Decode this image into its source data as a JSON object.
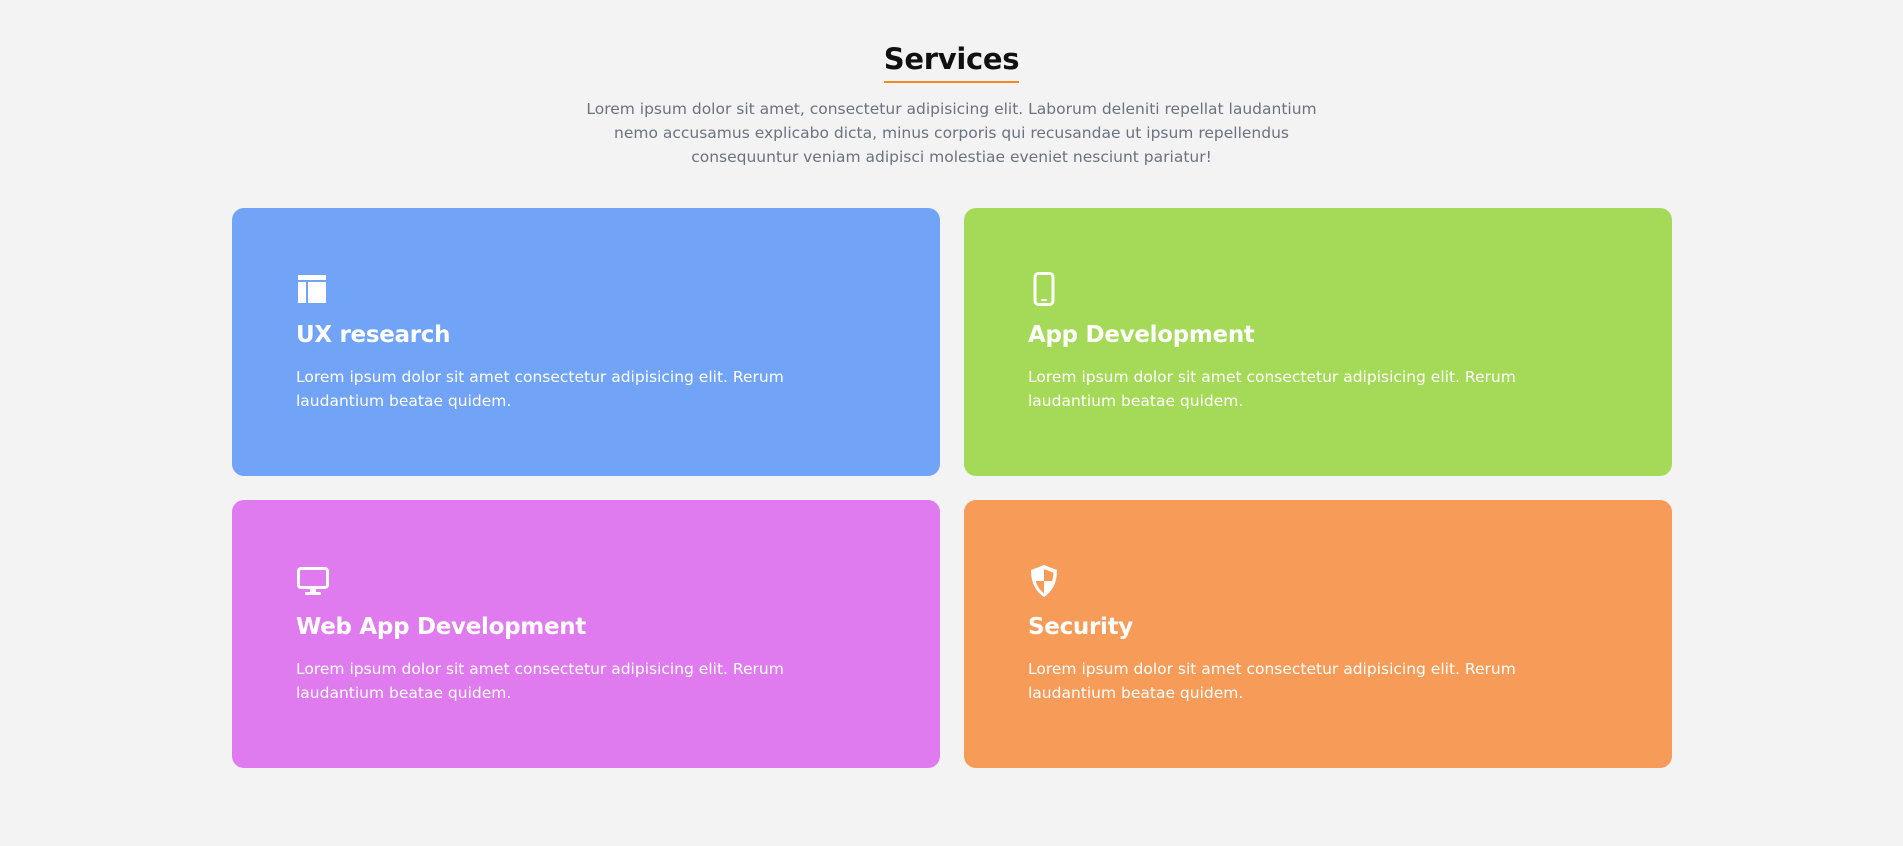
{
  "section": {
    "title": "Services",
    "intro": "Lorem ipsum dolor sit amet, consectetur adipisicing elit. Laborum deleniti repellat laudantium nemo accusamus explicabo dicta, minus corporis qui recusandae ut ipsum repellendus consequuntur veniam adipisci molestiae eveniet nesciunt pariatur!"
  },
  "cards": [
    {
      "icon": "layout-icon",
      "title": "UX research",
      "text": "Lorem ipsum dolor sit amet consectetur adipisicing elit. Rerum laudantium beatae quidem.",
      "color": "#71a3f7"
    },
    {
      "icon": "mobile-phone-icon",
      "title": "App Development",
      "text": "Lorem ipsum dolor sit amet consectetur adipisicing elit. Rerum laudantium beatae quidem.",
      "color": "#a5da58"
    },
    {
      "icon": "desktop-monitor-icon",
      "title": "Web App Development",
      "text": "Lorem ipsum dolor sit amet consectetur adipisicing elit. Rerum laudantium beatae quidem.",
      "color": "#df7bef"
    },
    {
      "icon": "shield-icon",
      "title": "Security",
      "text": "Lorem ipsum dolor sit amet consectetur adipisicing elit. Rerum laudantium beatae quidem.",
      "color": "#f79b58"
    }
  ],
  "colors": {
    "background": "#f3f3f3",
    "heading_underline": "#f08a24",
    "intro_text": "#6b7280"
  }
}
